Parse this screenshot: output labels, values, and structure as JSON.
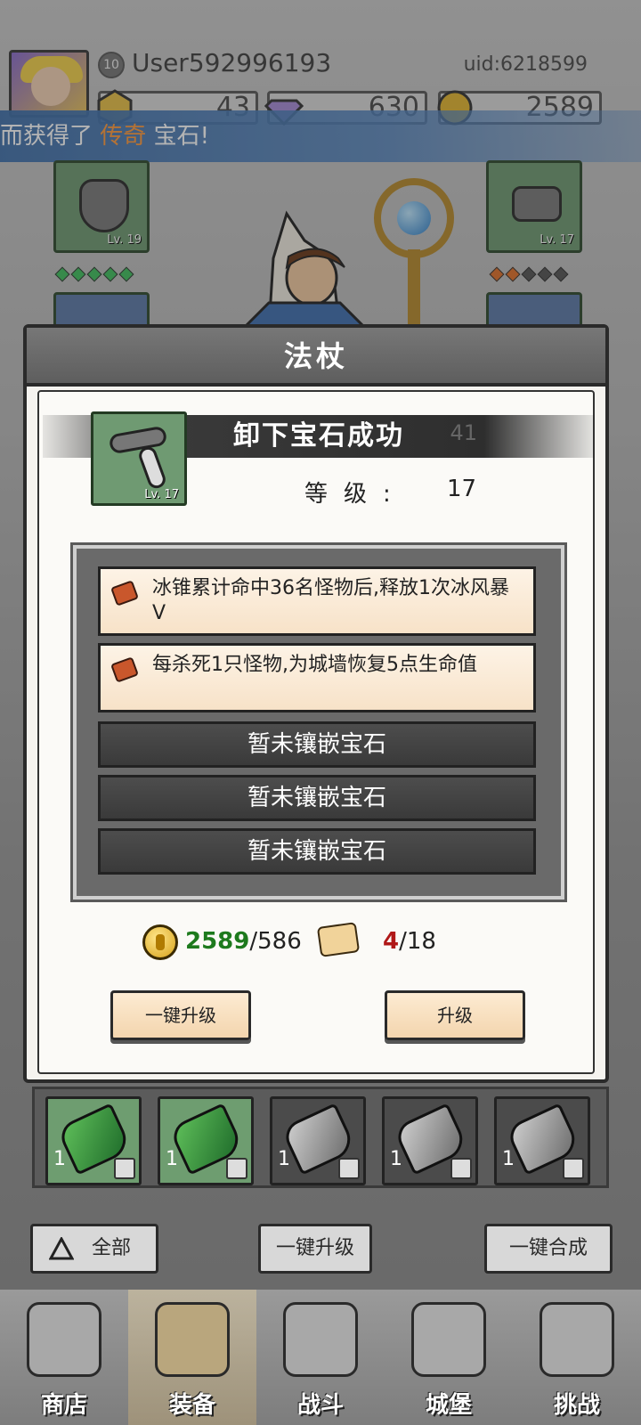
{
  "player": {
    "level": "10",
    "username": "User592996193",
    "uid": "uid:6218599"
  },
  "resources": {
    "energy": "43",
    "gems": "630",
    "gold": "2589"
  },
  "banner": {
    "prefix": "而获得了",
    "highlight": "传奇",
    "suffix": "宝石!"
  },
  "equip_slots": {
    "left_top_level": "Lv. 19",
    "right_top_level": "Lv. 17"
  },
  "modal": {
    "title": "法杖",
    "success": "卸下宝石成功",
    "faded_number": "41",
    "item_level_badge": "Lv. 17",
    "level_label": "等级:",
    "level_value": "17",
    "gems": [
      {
        "text": "冰锥累计命中36名怪物后,释放1次冰风暴V"
      },
      {
        "text": "每杀死1只怪物,为城墙恢复5点生命值"
      }
    ],
    "empty_slots": [
      "暂未镶嵌宝石",
      "暂未镶嵌宝石",
      "暂未镶嵌宝石"
    ],
    "cost": {
      "gold_have": "2589",
      "gold_need": "/586",
      "scroll_have": "4",
      "scroll_need": "/18"
    },
    "btn_upgrade_all": "一键升级",
    "btn_upgrade": "升级"
  },
  "gem_inventory": [
    {
      "count": "1",
      "color": "green"
    },
    {
      "count": "1",
      "color": "green"
    },
    {
      "count": "1",
      "color": "gray"
    },
    {
      "count": "1",
      "color": "gray"
    },
    {
      "count": "1",
      "color": "gray"
    }
  ],
  "filters": {
    "all": "全部",
    "upgrade_all": "一键升级",
    "merge_all": "一键合成"
  },
  "nav": {
    "shop": "商店",
    "equip": "装备",
    "battle": "战斗",
    "castle": "城堡",
    "challenge": "挑战"
  }
}
